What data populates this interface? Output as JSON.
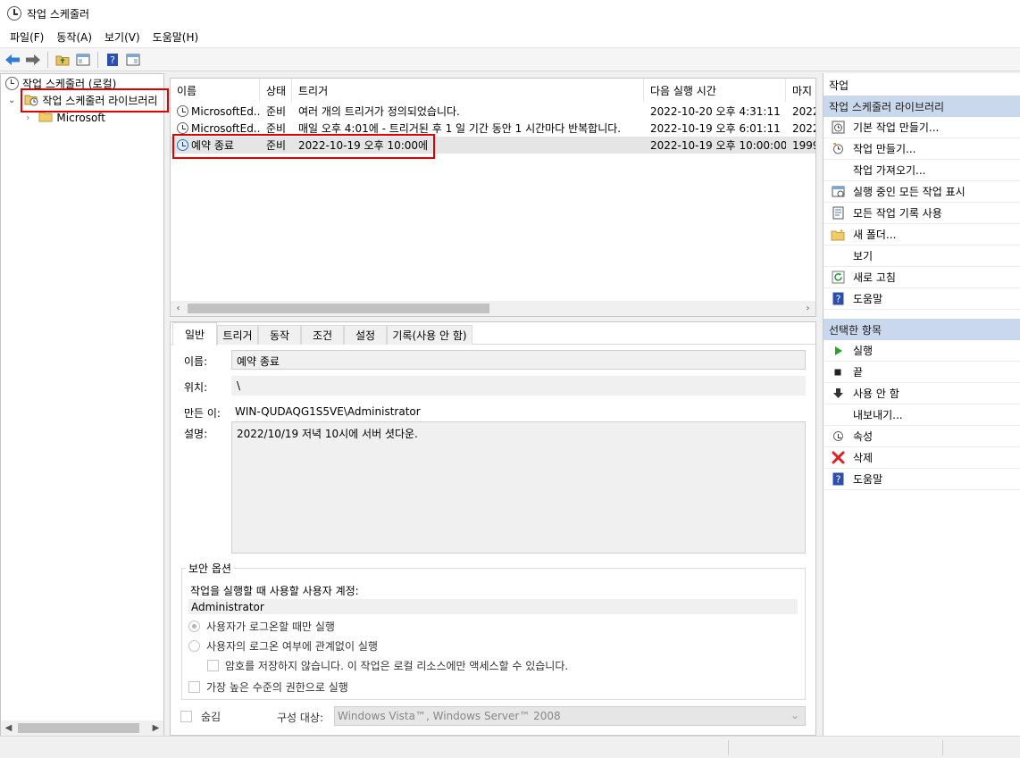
{
  "window": {
    "title": "작업 스케줄러"
  },
  "menu": [
    "파일(F)",
    "동작(A)",
    "보기(V)",
    "도움말(H)"
  ],
  "tree": {
    "root": "작업 스케줄러 (로컬)",
    "library": "작업 스케줄러 라이브러리",
    "child": "Microsoft"
  },
  "task_list": {
    "columns": [
      "이름",
      "상태",
      "트리거",
      "다음 실행 시간",
      "마지"
    ],
    "rows": [
      {
        "name": "MicrosoftEd...",
        "status": "준비",
        "trigger": "여러 개의 트리거가 정의되었습니다.",
        "next_run": "2022-10-20 오후 4:31:11",
        "last": "2022"
      },
      {
        "name": "MicrosoftEd...",
        "status": "준비",
        "trigger": "매일 오후 4:01에 - 트리거된 후 1 일 기간 동안 1 시간마다 반복합니다.",
        "next_run": "2022-10-19 오후 6:01:11",
        "last": "2022"
      },
      {
        "name": "예약 종료",
        "status": "준비",
        "trigger": "2022-10-19 오후 10:00에",
        "next_run": "2022-10-19 오후 10:00:00",
        "last": "1999"
      }
    ]
  },
  "detail": {
    "tabs": [
      "일반",
      "트리거",
      "동작",
      "조건",
      "설정",
      "기록(사용 안 함)"
    ],
    "name_label": "이름:",
    "name_value": "예약 종료",
    "location_label": "위치:",
    "location_value": "\\",
    "author_label": "만든 이:",
    "author_value": "WIN-QUDAQG1S5VE\\Administrator",
    "desc_label": "설명:",
    "desc_value": "2022/10/19 저녁 10시에 서버 셧다운.",
    "security_title": "보안 옵션",
    "account_prompt": "작업을 실행할 때 사용할 사용자 계정:",
    "account_value": "Administrator",
    "opt_logged_on": "사용자가 로그온할 때만 실행",
    "opt_whether": "사용자의 로그온 여부에 관계없이 실행",
    "opt_no_password": "암호를 저장하지 않습니다. 이 작업은 로컬 리소스에만 액세스할 수 있습니다.",
    "opt_highest": "가장 높은 수준의 권한으로 실행",
    "hidden_label": "숨김",
    "configure_label": "구성 대상:",
    "configure_value": "Windows Vista™, Windows Server™ 2008"
  },
  "actions": {
    "header": "작업",
    "section1_title": "작업 스케줄러 라이브러리",
    "section1_items": [
      "기본 작업 만들기...",
      "작업 만들기...",
      "작업 가져오기...",
      "실행 중인 모든 작업 표시",
      "모든 작업 기록 사용",
      "새 폴더...",
      "보기",
      "새로 고침",
      "도움말"
    ],
    "section2_title": "선택한 항목",
    "section2_items": [
      "실행",
      "끝",
      "사용 안 함",
      "내보내기...",
      "속성",
      "삭제",
      "도움말"
    ]
  }
}
